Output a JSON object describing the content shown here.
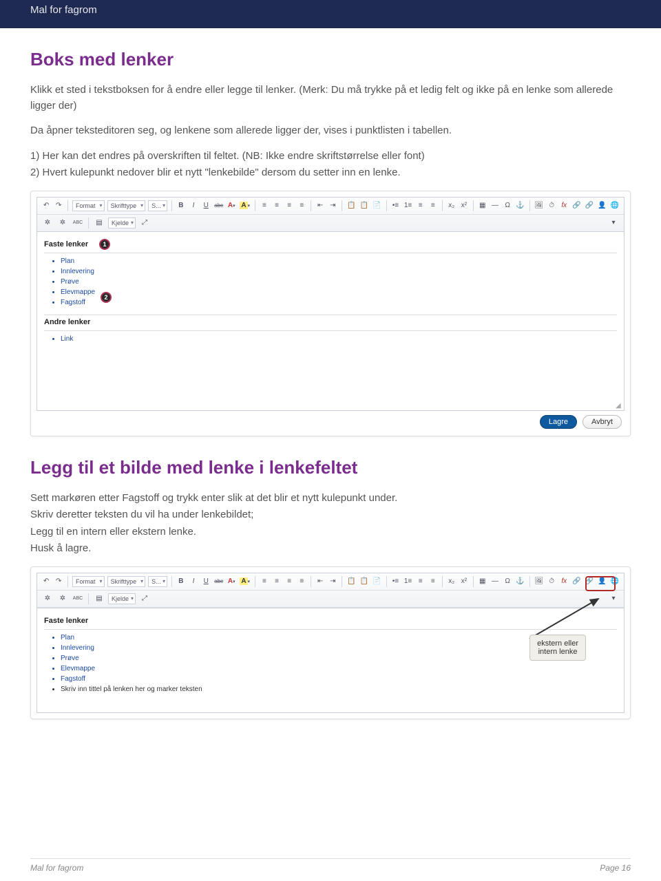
{
  "header": {
    "title": "Mal for fagrom"
  },
  "section1": {
    "heading": "Boks med lenker",
    "p1": "Klikk et sted i tekstboksen for å endre eller legge til lenker. (Merk: Du må trykke på et ledig felt og ikke på en lenke som allerede ligger der)",
    "p2": "Da åpner teksteditoren seg, og lenkene som allerede ligger der, vises i punktlisten i tabellen.",
    "p3": "1) Her kan det endres på overskriften til feltet. (NB: Ikke endre skriftstørrelse eller font)",
    "p4": "2) Hvert kulepunkt nedover blir et nytt \"lenkebilde\" dersom du setter inn en lenke."
  },
  "editor1": {
    "format": "Format",
    "fonttype": "Skrifttype",
    "size": "S...",
    "kjelde": "Kjelde",
    "heading1": "Faste lenker",
    "items1": [
      "Plan",
      "Innlevering",
      "Prøve",
      "Elevmappe",
      "Fagstoff"
    ],
    "heading2": "Andre lenker",
    "items2": [
      "Link"
    ],
    "callout1": "1",
    "callout2": "2",
    "save": "Lagre",
    "cancel": "Avbryt"
  },
  "section2": {
    "heading": "Legg til et bilde med lenke i lenkefeltet",
    "p1": "Sett markøren etter Fagstoff og trykk enter slik at det blir et nytt kulepunkt under.",
    "p2": "Skriv deretter teksten du vil ha under lenkebildet;",
    "p3": "Legg til en intern eller ekstern lenke.",
    "p4": "Husk å lagre."
  },
  "editor2": {
    "heading1": "Faste lenker",
    "items1": [
      "Plan",
      "Innlevering",
      "Prøve",
      "Elevmappe",
      "Fagstoff",
      "Skriv inn tittel på lenken her og marker teksten"
    ],
    "annotation": "ekstern eller\nintern lenke"
  },
  "footer": {
    "left": "Mal for fagrom",
    "right": "Page 16"
  },
  "icons": {
    "undo": "↶",
    "redo": "↷",
    "bold": "B",
    "italic": "I",
    "underline": "U",
    "strike": "abc",
    "acolor": "A",
    "abg": "A",
    "alignl": "≡",
    "alignc": "≡",
    "alignr": "≡",
    "alignj": "≡",
    "outdent": "⇤",
    "indent": "⇥",
    "paste1": "📋",
    "paste2": "📋",
    "paste3": "📄",
    "ul": "•≡",
    "ol": "1≡",
    "list": "≡",
    "sub": "x₂",
    "sup": "x²",
    "table": "▦",
    "hr": "—",
    "omega": "Ω",
    "anchor": "⚓",
    "img1": "🖼",
    "clock": "⏱",
    "fx": "fx",
    "link1": "🔗",
    "link2": "🔗",
    "user": "👤",
    "globe": "🌐",
    "spell1": "✲",
    "spell2": "✲",
    "abc": "ABC",
    "code": "▤",
    "expand": "⤢",
    "more": "▾"
  }
}
